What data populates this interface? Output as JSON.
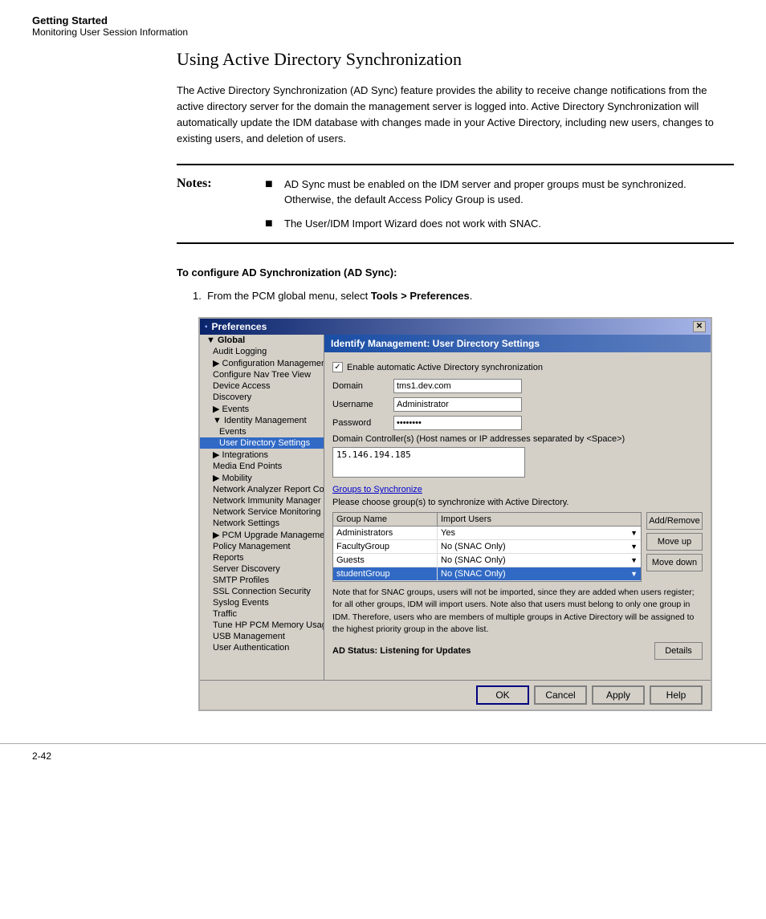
{
  "header": {
    "bold_title": "Getting Started",
    "subtitle": "Monitoring User Session Information"
  },
  "page": {
    "doc_title": "Using Active Directory Synchronization",
    "doc_body": "The Active Directory Synchronization (AD Sync) feature provides the ability to receive change notifications from the active directory server for the domain the management server is logged into. Active Directory Synchronization will automatically update the IDM database with changes made in your Active Directory, including new users, changes to existing users, and deletion of users.",
    "notes_label": "Notes:",
    "notes": [
      "AD Sync must be enabled on the IDM server and proper groups must be synchronized. Otherwise, the default Access Policy Group is used.",
      "The User/IDM Import Wizard does not work with SNAC."
    ],
    "procedure_title": "To configure AD Synchronization (AD Sync):",
    "procedure_steps": [
      "From the PCM global menu, select Tools > Preferences."
    ]
  },
  "dialog": {
    "title": "Preferences",
    "close_btn": "✕",
    "nav_items": [
      {
        "label": "▼ Global",
        "indent": 0,
        "bold": true
      },
      {
        "label": "Audit Logging",
        "indent": 1
      },
      {
        "label": "▶ Configuration Management",
        "indent": 1
      },
      {
        "label": "Configure Nav Tree View",
        "indent": 1
      },
      {
        "label": "Device Access",
        "indent": 1
      },
      {
        "label": "Discovery",
        "indent": 1
      },
      {
        "label": "▶ Events",
        "indent": 1
      },
      {
        "label": "▼ Identity Management",
        "indent": 1
      },
      {
        "label": "Events",
        "indent": 2
      },
      {
        "label": "User Directory Settings",
        "indent": 2,
        "selected": true
      },
      {
        "label": "▶ Integrations",
        "indent": 1
      },
      {
        "label": "Media End Points",
        "indent": 1
      },
      {
        "label": "▶ Mobility",
        "indent": 1
      },
      {
        "label": "Network Analyzer Report Config",
        "indent": 1
      },
      {
        "label": "Network Immunity Manager",
        "indent": 1
      },
      {
        "label": "Network Service Monitoring",
        "indent": 1
      },
      {
        "label": "Network Settings",
        "indent": 1
      },
      {
        "label": "▶ PCM Upgrade Management",
        "indent": 1
      },
      {
        "label": "Policy Management",
        "indent": 1
      },
      {
        "label": "Reports",
        "indent": 1
      },
      {
        "label": "Server Discovery",
        "indent": 1
      },
      {
        "label": "SMTP Profiles",
        "indent": 1
      },
      {
        "label": "SSL Connection Security",
        "indent": 1
      },
      {
        "label": "Syslog Events",
        "indent": 1
      },
      {
        "label": "Traffic",
        "indent": 1
      },
      {
        "label": "Tune HP PCM Memory Usage",
        "indent": 1
      },
      {
        "label": "USB Management",
        "indent": 1
      },
      {
        "label": "User Authentication",
        "indent": 1
      }
    ],
    "panel_header": "Identify Management: User Directory Settings",
    "checkbox_label": "Enable automatic Active Directory synchronization",
    "checkbox_checked": true,
    "domain_label": "Domain",
    "domain_value": "tms1.dev.com",
    "username_label": "Username",
    "username_value": "Administrator",
    "password_label": "Password",
    "password_value": "●●●●●●●",
    "dc_label": "Domain Controller(s) (Host names or IP addresses separated by <Space>)",
    "dc_value": "15.146.194.185",
    "groups_link": "Groups to Synchronize",
    "groups_desc": "Please choose group(s) to synchronize with Active Directory.",
    "groups_columns": [
      "Group Name",
      "Import Users"
    ],
    "groups_rows": [
      {
        "name": "Administrators",
        "import": "Yes",
        "selected": false
      },
      {
        "name": "FacultyGroup",
        "import": "No (SNAC Only)",
        "selected": false
      },
      {
        "name": "Guests",
        "import": "No (SNAC Only)",
        "selected": false
      },
      {
        "name": "studentGroup",
        "import": "No (SNAC Only)",
        "selected": true
      }
    ],
    "btn_add_remove": "Add/Remove",
    "btn_move_up": "Move up",
    "btn_move_down": "Move down",
    "note_text": "Note that for SNAC groups, users will not be imported, since they are added when users register; for all other groups, IDM will import users. Note also that users must belong to only one group in IDM. Therefore, users who are members of multiple groups in Active Directory will be assigned to the highest priority group in the above list.",
    "ad_status_label": "AD Status: Listening for Updates",
    "btn_details": "Details",
    "btn_ok": "OK",
    "btn_cancel": "Cancel",
    "btn_apply": "Apply",
    "btn_help": "Help"
  },
  "footer": {
    "page_number": "2-42"
  }
}
